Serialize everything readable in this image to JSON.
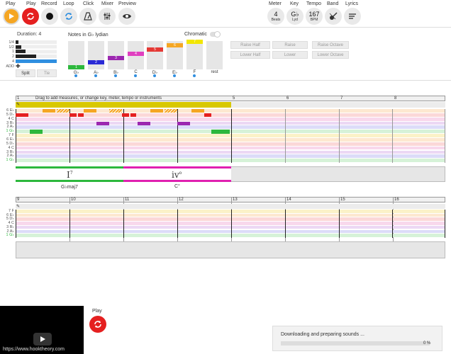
{
  "toolbar": {
    "left_labels": [
      "Play",
      "Play",
      "Record",
      "Loop",
      "Click",
      "Mixer",
      "Preview"
    ],
    "meter": {
      "label": "Meter",
      "value": "4",
      "sub": "Beats"
    },
    "key": {
      "label": "Key",
      "value": "G♭",
      "sub": "Lyd"
    },
    "tempo": {
      "label": "Tempo",
      "value": "167",
      "sub": "BPM"
    },
    "band": {
      "label": "Band"
    },
    "lyrics": {
      "label": "Lyrics"
    }
  },
  "duration": {
    "label": "Duration: 4",
    "rows": [
      "1/4",
      "1/2",
      "1",
      "2",
      "4"
    ],
    "add": "ADD",
    "split": "Split",
    "tie": "Tie"
  },
  "notes": {
    "title": "Notes in G♭ lydian",
    "chromatic": "Chromatic",
    "columns": [
      {
        "degree": "1",
        "name": "G♭",
        "color": "#2db83d"
      },
      {
        "degree": "2",
        "name": "A♭",
        "color": "#2a2ad6"
      },
      {
        "degree": "3",
        "name": "B♭",
        "color": "#9c27b0"
      },
      {
        "degree": "4",
        "name": "C",
        "color": "#e040c0"
      },
      {
        "degree": "5",
        "name": "D♭",
        "color": "#e53935"
      },
      {
        "degree": "6",
        "name": "E♭",
        "color": "#f5a623"
      },
      {
        "degree": "7",
        "name": "F",
        "color": "#f2e600"
      },
      {
        "degree": "",
        "name": "rest",
        "color": ""
      }
    ],
    "buttons": [
      "Raise Half",
      "Raise",
      "Raise Octave",
      "Lower Half",
      "Lower",
      "Lower Octave"
    ]
  },
  "timeline1": {
    "hint": "Drag to add measures, or change key, meter, tempo or instruments",
    "measures": [
      "1",
      "5",
      "6",
      "7",
      "8"
    ],
    "row_labels": [
      "6 E♭",
      "5 D♭",
      "4 C",
      "3 B♭",
      "2 A♭",
      "1 G♭",
      "7 F",
      "6 E♭",
      "5 D♭",
      "4 C",
      "3 B♭",
      "2 A♭",
      "1 G♭"
    ],
    "chords": [
      {
        "roman": "I",
        "sup": "7",
        "name": "G♭maj7"
      },
      {
        "roman": "iv",
        "sup": "o",
        "name": "C°"
      }
    ]
  },
  "timeline2": {
    "measures": [
      "9",
      "10",
      "11",
      "12",
      "13",
      "14",
      "15",
      "16"
    ],
    "row_labels": [
      "7 F",
      "6 E♭",
      "5 D♭",
      "4 C",
      "3 B♭",
      "2 A♭",
      "1 G♭"
    ]
  },
  "bottom": {
    "play": "Play",
    "url": "https://www.hooktheory.com",
    "downloading": "Downloading and preparing sounds ...",
    "percent": "0 %"
  }
}
